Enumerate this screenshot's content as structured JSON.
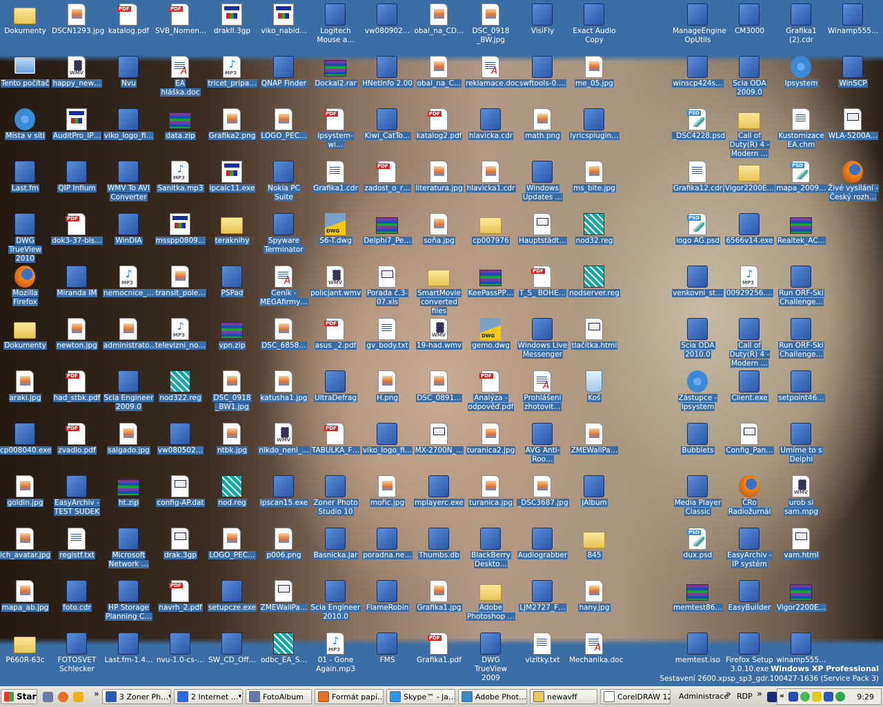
{
  "desktop": {
    "rows": [
      [
        {
          "l": "Dokumenty",
          "t": "folder"
        },
        {
          "l": "DSCN1293.jpg",
          "t": "jpg"
        },
        {
          "l": "katalog.pdf",
          "t": "pdf"
        },
        {
          "l": "SVB_Nomen…",
          "t": "pdf"
        },
        {
          "l": "drakII.3gp",
          "t": "exe"
        },
        {
          "l": "viko_nabid…",
          "t": "exe"
        },
        {
          "l": "Logitech Mouse a…",
          "t": "app"
        },
        {
          "l": "vw080902…",
          "t": "app"
        },
        {
          "l": "obal_na_CD…",
          "t": "jpg"
        },
        {
          "l": "DSC_0918 _BW.jpg",
          "t": "jpg"
        },
        {
          "l": "VisiFly",
          "t": "app"
        },
        {
          "l": "Exact Audio Copy",
          "t": "app"
        },
        {
          "l": "ManageEngine OpUtils",
          "t": "app"
        },
        {
          "l": "CM3000",
          "t": "app"
        },
        {
          "l": "Grafika1 (2).cdr",
          "t": "app"
        },
        {
          "l": "Winamp555…",
          "t": "app"
        }
      ],
      [
        {
          "l": "Tento počítač",
          "t": "pc"
        },
        {
          "l": "happy_new…",
          "t": "wmv"
        },
        {
          "l": "Nvu",
          "t": "app"
        },
        {
          "l": "EA hláška.doc",
          "t": "doc"
        },
        {
          "l": "tricet_pripa…",
          "t": "mp3"
        },
        {
          "l": "QNAP Finder",
          "t": "app"
        },
        {
          "l": "Dockal2.rar",
          "t": "rar"
        },
        {
          "l": "HNetInfo 2.00",
          "t": "app"
        },
        {
          "l": "obal_na_C…",
          "t": "jpg"
        },
        {
          "l": "reklamace.doc",
          "t": "doc"
        },
        {
          "l": "swftools-0….",
          "t": "app"
        },
        {
          "l": "me_05.jpg",
          "t": "jpg"
        },
        {
          "l": "winscp424s…",
          "t": "app"
        },
        {
          "l": "Scia ODA 2009.0",
          "t": "app"
        },
        {
          "l": "Ipsystem",
          "t": "net"
        },
        {
          "l": "WinSCP",
          "t": "app"
        }
      ],
      [
        {
          "l": "Místa v síti",
          "t": "net"
        },
        {
          "l": "AuditPro_IP…",
          "t": "exe"
        },
        {
          "l": "viko_logo_fi…",
          "t": "app"
        },
        {
          "l": "data.zip",
          "t": "rar"
        },
        {
          "l": "Grafika2.png",
          "t": "jpg"
        },
        {
          "l": "LOGO_PEC…",
          "t": "jpg"
        },
        {
          "l": "ipsystem-wi…",
          "t": "pdf"
        },
        {
          "l": "Kiwi_CatTo…",
          "t": "app"
        },
        {
          "l": "katalog2.pdf",
          "t": "pdf"
        },
        {
          "l": "hlavicka.cdr",
          "t": "app"
        },
        {
          "l": "math.png",
          "t": "jpg"
        },
        {
          "l": "lyricsplugin…",
          "t": "app"
        },
        {
          "l": "_DSC4228.psd",
          "t": "psd"
        },
        {
          "l": "Call of Duty(R) 4 - Modern …",
          "t": "folder"
        },
        {
          "l": "Kustomizace EA.chm",
          "t": "txt"
        },
        {
          "l": "WLA-5200A…",
          "t": "html"
        }
      ],
      [
        {
          "l": "Last.fm",
          "t": "app"
        },
        {
          "l": "QIP Infium",
          "t": "app"
        },
        {
          "l": "WMV To AVI Converter",
          "t": "app"
        },
        {
          "l": "Sanitka.mp3",
          "t": "mp3"
        },
        {
          "l": "ipcalc11.exe",
          "t": "exe"
        },
        {
          "l": "Nokia PC Suite",
          "t": "app"
        },
        {
          "l": "Grafika1.cdr",
          "t": "txt"
        },
        {
          "l": "zadost_o_r…",
          "t": "pdf"
        },
        {
          "l": "literatura.jpg",
          "t": "jpg"
        },
        {
          "l": "hlavicka1.cdr",
          "t": "jpg"
        },
        {
          "l": "Windows Updates …",
          "t": "app"
        },
        {
          "l": "ms_bite.jpg",
          "t": "jpg"
        },
        {
          "l": "Grafika12.cdr",
          "t": "txt"
        },
        {
          "l": "Vigor2200E…",
          "t": "folder"
        },
        {
          "l": "mapa_2009…",
          "t": "psd"
        },
        {
          "l": "Živé vysílání - Český rozh…",
          "t": "ff"
        }
      ],
      [
        {
          "l": "DWG TrueView 2010",
          "t": "app"
        },
        {
          "l": "dok3-37-bis…",
          "t": "pdf"
        },
        {
          "l": "WinDIA",
          "t": "app"
        },
        {
          "l": "msspp0809…",
          "t": "exe"
        },
        {
          "l": "teraknihy",
          "t": "folder"
        },
        {
          "l": "Spyware Terminator",
          "t": "app"
        },
        {
          "l": "S6-T.dwg",
          "t": "dwg"
        },
        {
          "l": "Delphi7_Pe…",
          "t": "rar"
        },
        {
          "l": "soňa.jpg",
          "t": "jpg"
        },
        {
          "l": "cp007976",
          "t": "folder"
        },
        {
          "l": "Hauptstädt…",
          "t": "html"
        },
        {
          "l": "nod32.reg",
          "t": "reg"
        },
        {
          "l": "logo AG.psd",
          "t": "psd"
        },
        {
          "l": "6566v14.exe",
          "t": "app"
        },
        {
          "l": "Realtek_AC…",
          "t": "rar"
        },
        null
      ],
      [
        {
          "l": "Mozilla Firefox",
          "t": "ff"
        },
        {
          "l": "Miranda IM",
          "t": "app"
        },
        {
          "l": "nemocnice_…",
          "t": "mp3"
        },
        {
          "l": "transit_pole…",
          "t": "jpg"
        },
        {
          "l": "PSPad",
          "t": "app"
        },
        {
          "l": "Ceník - MEGAfirmy…",
          "t": "doc"
        },
        {
          "l": "policjant.wmv",
          "t": "wmv"
        },
        {
          "l": "Porada č.3-07.xls",
          "t": "html"
        },
        {
          "l": "SmartMovie converted files",
          "t": "folder"
        },
        {
          "l": "KeePassPP…",
          "t": "rar"
        },
        {
          "l": "T_S_ BOHE…",
          "t": "pdf"
        },
        {
          "l": "nodserver.reg",
          "t": "reg"
        },
        {
          "l": "venkovni_st…",
          "t": "app"
        },
        {
          "l": "00929256….",
          "t": "mp3"
        },
        {
          "l": "Run ORF-Ski Challenge…",
          "t": "app"
        },
        null
      ],
      [
        {
          "l": "Dokumenty",
          "t": "folder"
        },
        {
          "l": "newton.jpg",
          "t": "jpg"
        },
        {
          "l": "administrato…",
          "t": "jpg"
        },
        {
          "l": "televizni_no…",
          "t": "mp3"
        },
        {
          "l": "vpn.zip",
          "t": "rar"
        },
        {
          "l": "DSC_6858…",
          "t": "jpg"
        },
        {
          "l": "asus _2.pdf",
          "t": "pdf"
        },
        {
          "l": "gv_body.txt",
          "t": "txt"
        },
        {
          "l": "19-had.wmv",
          "t": "wmv"
        },
        {
          "l": "gemo.dwg",
          "t": "dwg"
        },
        {
          "l": "Windows Live Messenger",
          "t": "app"
        },
        {
          "l": "tlačítka.html",
          "t": "html"
        },
        {
          "l": "Scia ODA 2010.0",
          "t": "app"
        },
        {
          "l": "Call of Duty(R) 4 - Modern …",
          "t": "app"
        },
        {
          "l": "Run ORF-Ski Challenge…",
          "t": "app"
        },
        null
      ],
      [
        {
          "l": "araki.jpg",
          "t": "jpg"
        },
        {
          "l": "had_stbk.pdf",
          "t": "pdf"
        },
        {
          "l": "Scia Engineer 2009.0",
          "t": "app"
        },
        {
          "l": "nod322.reg",
          "t": "reg"
        },
        {
          "l": "DSC_0918 _BW1.jpg",
          "t": "jpg"
        },
        {
          "l": "katusha1.jpg",
          "t": "jpg"
        },
        {
          "l": "UltraDefrag",
          "t": "app"
        },
        {
          "l": "H.png",
          "t": "jpg"
        },
        {
          "l": "DSC_0891…",
          "t": "jpg"
        },
        {
          "l": "Analýza - odpověď.pdf",
          "t": "pdf"
        },
        {
          "l": "Prohlášení zhotovit…",
          "t": "doc"
        },
        {
          "l": "Koš",
          "t": "bin"
        },
        {
          "l": "Zástupce - Ipsystem",
          "t": "net"
        },
        {
          "l": "Client.exe",
          "t": "app"
        },
        {
          "l": "setpoint46…",
          "t": "app"
        },
        null
      ],
      [
        {
          "l": "cp008040.exe",
          "t": "app"
        },
        {
          "l": "zvadlo.pdf",
          "t": "pdf"
        },
        {
          "l": "salgado.jpg",
          "t": "jpg"
        },
        {
          "l": "vw080502…",
          "t": "app"
        },
        {
          "l": "ntbk.jpg",
          "t": "jpg"
        },
        {
          "l": "nikdo_neni_…",
          "t": "wmv"
        },
        {
          "l": "TABULKA_F…",
          "t": "pdf"
        },
        {
          "l": "viko_logo_fi…",
          "t": "app"
        },
        {
          "l": "MX-2700N_…",
          "t": "html"
        },
        {
          "l": "turanica2.jpg",
          "t": "jpg"
        },
        {
          "l": "AVG Anti-Roo…",
          "t": "app"
        },
        {
          "l": "ZMEWallPa…",
          "t": "jpg"
        },
        {
          "l": "Bubblets",
          "t": "app"
        },
        {
          "l": "Config_Pan…",
          "t": "html"
        },
        {
          "l": "Umíme to s Delphi",
          "t": "app"
        },
        null
      ],
      [
        {
          "l": "goldin.jpg",
          "t": "jpg"
        },
        {
          "l": "EasyArchiv - TEST SUDEK",
          "t": "app"
        },
        {
          "l": "ht.zip",
          "t": "rar"
        },
        {
          "l": "config-AP.dat",
          "t": "html"
        },
        {
          "l": "nod.reg",
          "t": "reg"
        },
        {
          "l": "ipscan15.exe",
          "t": "app"
        },
        {
          "l": "Zoner Photo Studio 10",
          "t": "app"
        },
        {
          "l": "mořic.jpg",
          "t": "jpg"
        },
        {
          "l": "mplayerc.exe",
          "t": "app"
        },
        {
          "l": "turanica.jpg",
          "t": "jpg"
        },
        {
          "l": "_DSC3687.jpg",
          "t": "jpg"
        },
        {
          "l": "JAlbum",
          "t": "app"
        },
        {
          "l": "Media Player Classic",
          "t": "app"
        },
        {
          "l": "ČRo Radiožurnál",
          "t": "ff"
        },
        {
          "l": "urob si sam.mpg",
          "t": "wmv"
        },
        null
      ],
      [
        {
          "l": "ich_avatar.jpg",
          "t": "jpg"
        },
        {
          "l": "registf.txt",
          "t": "txt"
        },
        {
          "l": "Microsoft Network …",
          "t": "app"
        },
        {
          "l": "drak.3gp",
          "t": "html"
        },
        {
          "l": "LOGO_PEC…",
          "t": "jpg"
        },
        {
          "l": "p006.png",
          "t": "jpg"
        },
        {
          "l": "Basnicka.jar",
          "t": "app"
        },
        {
          "l": "poradna.ne…",
          "t": "app"
        },
        {
          "l": "Thumbs.db",
          "t": "app"
        },
        {
          "l": "BlackBerry Deskto…",
          "t": "app"
        },
        {
          "l": "Audiograbber",
          "t": "app"
        },
        {
          "l": "845",
          "t": "folder"
        },
        {
          "l": "dux.psd",
          "t": "psd"
        },
        {
          "l": "EasyArchiv - IP systém",
          "t": "app"
        },
        {
          "l": "vam.html",
          "t": "html"
        },
        null
      ],
      [
        {
          "l": "mapa_ab.jpg",
          "t": "jpg"
        },
        {
          "l": "foto.cdr",
          "t": "app"
        },
        {
          "l": "HP Storage Planning C…",
          "t": "app"
        },
        {
          "l": "navrh_2.pdf",
          "t": "pdf"
        },
        {
          "l": "setupcze.exe",
          "t": "app"
        },
        {
          "l": "ZMEWallPa…",
          "t": "html"
        },
        {
          "l": "Scia Engineer 2010.0",
          "t": "app"
        },
        {
          "l": "FlameRobin",
          "t": "app"
        },
        {
          "l": "Grafika1.jpg",
          "t": "jpg"
        },
        {
          "l": "Adobe Photoshop …",
          "t": "folder"
        },
        {
          "l": "LJM2727_F…",
          "t": "app"
        },
        {
          "l": "hany.jpg",
          "t": "jpg"
        },
        {
          "l": "memtest86…",
          "t": "rar"
        },
        {
          "l": "EasyBuilder",
          "t": "app"
        },
        {
          "l": "Vigor2200E…",
          "t": "rar"
        },
        null
      ],
      [
        {
          "l": "P660R-63c",
          "t": "folder"
        },
        {
          "l": "FOTOSVET Schlecker",
          "t": "app"
        },
        {
          "l": "Last.fm-1.4…",
          "t": "app"
        },
        {
          "l": "nvu-1.0-cs-…",
          "t": "app"
        },
        {
          "l": "SW_CD_Off…",
          "t": "app"
        },
        {
          "l": "odbc_EA_S…",
          "t": "reg"
        },
        {
          "l": "01 - Gone Again.mp3",
          "t": "mp3"
        },
        {
          "l": "FMS",
          "t": "app"
        },
        {
          "l": "Grafika1.pdf",
          "t": "pdf"
        },
        {
          "l": "DWG TrueView 2009",
          "t": "app"
        },
        {
          "l": "vizitky.txt",
          "t": "txt"
        },
        {
          "l": "Mechanika.doc",
          "t": "doc"
        },
        {
          "l": "memtest.iso",
          "t": "app"
        },
        {
          "l": "Firefox Setup 3.0.10.exe",
          "t": "app"
        },
        {
          "l": "winamp555…",
          "t": "app"
        },
        null
      ]
    ]
  },
  "watermark": {
    "edition": "Windows XP Professional",
    "build": "Sestavení 2600.xpsp_sp3_gdr.100427-1636 (Service Pack 3)"
  },
  "taskbar": {
    "start": "Start",
    "chevron": "»",
    "tasks": [
      "3 Zoner Ph…",
      "2 Internet …",
      "FotoAlbum",
      "Formát papí…",
      "Skype™ - ja…",
      "Adobe Phot…",
      "newavff",
      "CorelDRAW 12"
    ],
    "toolbars": [
      "Administrace",
      "»",
      "RDP",
      "»"
    ],
    "tray_expand": "«",
    "clock": "9:29",
    "colors": {
      "accent": "#3a6ea5",
      "label_bg": "#3b6ea7"
    }
  }
}
